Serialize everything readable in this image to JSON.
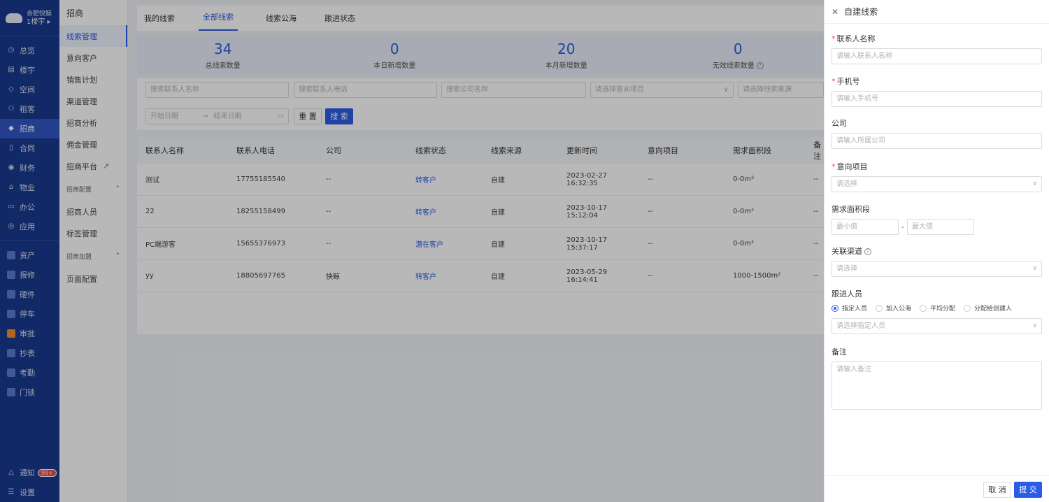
{
  "nav": {
    "org_name": "合肥快鲸",
    "org_sub": "1楼宇",
    "items": [
      {
        "label": "总览",
        "icon": "clock-icon"
      },
      {
        "label": "楼宇",
        "icon": "building-icon"
      },
      {
        "label": "空间",
        "icon": "cube-icon"
      },
      {
        "label": "租客",
        "icon": "users-icon"
      },
      {
        "label": "招商",
        "icon": "tag-icon"
      },
      {
        "label": "合同",
        "icon": "document-icon"
      },
      {
        "label": "财务",
        "icon": "coin-icon"
      },
      {
        "label": "物业",
        "icon": "home-icon"
      },
      {
        "label": "办公",
        "icon": "monitor-icon"
      },
      {
        "label": "应用",
        "icon": "app-icon"
      }
    ],
    "apps": [
      {
        "label": "资产"
      },
      {
        "label": "报修"
      },
      {
        "label": "硬件"
      },
      {
        "label": "停车"
      },
      {
        "label": "审批"
      },
      {
        "label": "抄表"
      },
      {
        "label": "考勤"
      },
      {
        "label": "门锁"
      }
    ],
    "notify": "通知",
    "notify_badge": "99+",
    "settings": "设置"
  },
  "subnav": {
    "title": "招商",
    "items": [
      "线索管理",
      "意向客户",
      "销售计划",
      "渠道管理",
      "招商分析",
      "佣金管理",
      "招商平台"
    ],
    "group1": "招商配置",
    "group1_items": [
      "招商人员",
      "标签管理"
    ],
    "group2": "招商加盟",
    "group2_items": [
      "页面配置"
    ]
  },
  "tabs": [
    "我的线索",
    "全部线索",
    "线索公海",
    "跟进状态"
  ],
  "stats": [
    {
      "value": "34",
      "label": "总线索数量"
    },
    {
      "value": "0",
      "label": "本日新增数量"
    },
    {
      "value": "20",
      "label": "本月新增数量"
    },
    {
      "value": "0",
      "label": "无效线索数量"
    }
  ],
  "filters": {
    "contact_name": "搜索联系人名称",
    "contact_phone": "搜索联系人电话",
    "company": "搜索公司名称",
    "project": "请选择意向项目",
    "source": "请选择线索来源",
    "start_date": "开始日期",
    "end_date": "结束日期",
    "reset": "重 置",
    "search": "搜 索"
  },
  "table": {
    "columns": [
      "联系人名称",
      "联系人电话",
      "公司",
      "线索状态",
      "线索来源",
      "更新时间",
      "意向项目",
      "需求面积段",
      "备注"
    ],
    "rows": [
      [
        "测试",
        "17755185540",
        "--",
        "转客户",
        "自建",
        "2023-02-27 16:32:35",
        "--",
        "0-0m²",
        "--"
      ],
      [
        "22",
        "18255158499",
        "--",
        "转客户",
        "自建",
        "2023-10-17 15:12:04",
        "--",
        "0-0m²",
        "--"
      ],
      [
        "PC端游客",
        "15655376973",
        "--",
        "潜在客户",
        "自建",
        "2023-10-17 15:37:17",
        "--",
        "0-0m²",
        "--"
      ],
      [
        "yy",
        "18805697765",
        "快鲸",
        "转客户",
        "自建",
        "2023-05-29 16:14:41",
        "--",
        "1000-1500m²",
        "--"
      ]
    ]
  },
  "drawer": {
    "title": "自建线索",
    "contact_label": "联系人名称",
    "contact_ph": "请输入联系人名称",
    "phone_label": "手机号",
    "phone_ph": "请输入手机号",
    "company_label": "公司",
    "company_ph": "请输入所属公司",
    "project_label": "意向项目",
    "project_ph": "请选择",
    "area_label": "需求面积段",
    "area_min": "最小值",
    "area_dash": "-",
    "area_max": "最大值",
    "channel_label": "关联渠道",
    "channel_ph": "请选择",
    "follower_label": "跟进人员",
    "radio_options": [
      "指定人员",
      "加入公海",
      "平均分配",
      "分配给创建人"
    ],
    "follower_ph": "请选择指定人员",
    "remark_label": "备注",
    "remark_ph": "请输入备注",
    "cancel": "取 消",
    "submit": "提 交"
  }
}
